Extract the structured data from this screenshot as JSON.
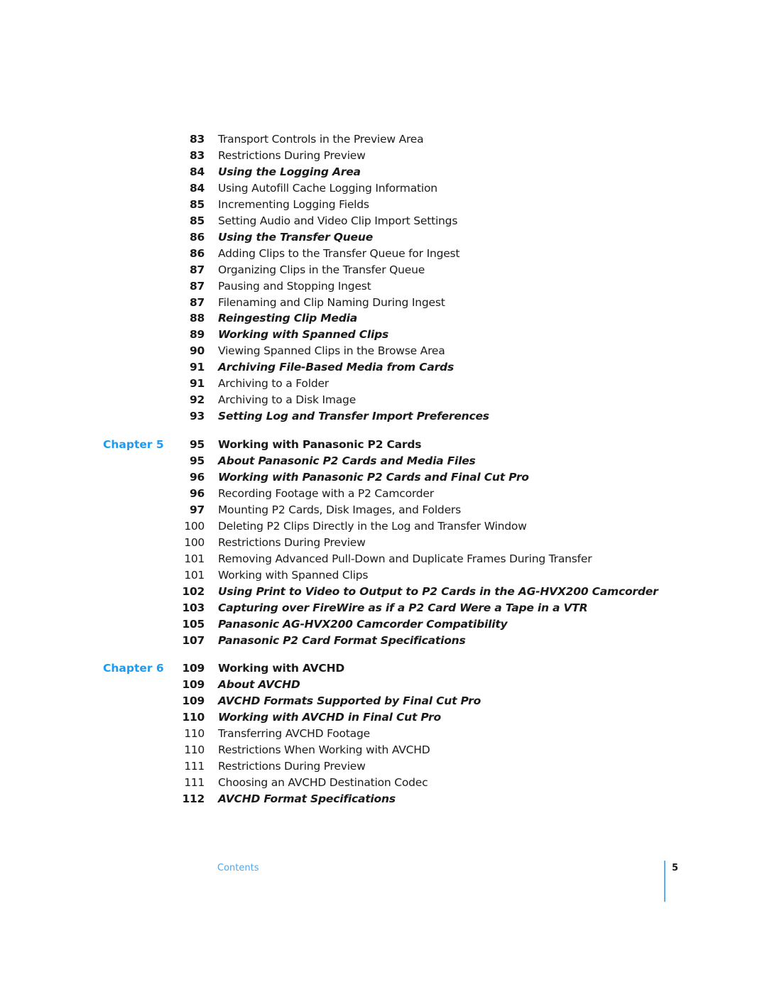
{
  "entries": [
    {
      "page": "83",
      "title": "Transport Controls in the Preview Area",
      "style": "plain"
    },
    {
      "page": "83",
      "title": "Restrictions During Preview",
      "style": "plain"
    },
    {
      "page": "84",
      "title": "Using the Logging Area",
      "style": "italic"
    },
    {
      "page": "84",
      "title": "Using Autofill Cache Logging Information",
      "style": "plain"
    },
    {
      "page": "85",
      "title": "Incrementing Logging Fields",
      "style": "plain"
    },
    {
      "page": "85",
      "title": "Setting Audio and Video Clip Import Settings",
      "style": "plain"
    },
    {
      "page": "86",
      "title": "Using the Transfer Queue",
      "style": "italic"
    },
    {
      "page": "86",
      "title": "Adding Clips to the Transfer Queue for Ingest",
      "style": "plain"
    },
    {
      "page": "87",
      "title": "Organizing Clips in the Transfer Queue",
      "style": "plain"
    },
    {
      "page": "87",
      "title": "Pausing and Stopping Ingest",
      "style": "plain"
    },
    {
      "page": "87",
      "title": "Filenaming and Clip Naming During Ingest",
      "style": "plain"
    },
    {
      "page": "88",
      "title": "Reingesting Clip Media",
      "style": "italic"
    },
    {
      "page": "89",
      "title": "Working with Spanned Clips",
      "style": "italic"
    },
    {
      "page": "90",
      "title": "Viewing Spanned Clips in the Browse Area",
      "style": "plain"
    },
    {
      "page": "91",
      "title": "Archiving File-Based Media from Cards",
      "style": "italic"
    },
    {
      "page": "91",
      "title": "Archiving to a Folder",
      "style": "plain"
    },
    {
      "page": "92",
      "title": "Archiving to a Disk Image",
      "style": "plain"
    },
    {
      "page": "93",
      "title": "Setting Log and Transfer Import Preferences",
      "style": "italic"
    },
    {
      "chapter": "Chapter 5",
      "page": "95",
      "title": "Working with Panasonic P2 Cards",
      "style": "chapter"
    },
    {
      "page": "95",
      "title": "About Panasonic P2 Cards and Media Files",
      "style": "italic"
    },
    {
      "page": "96",
      "title": "Working with Panasonic P2 Cards and Final Cut Pro",
      "style": "italic"
    },
    {
      "page": "96",
      "title": "Recording Footage with a P2 Camcorder",
      "style": "plain"
    },
    {
      "page": "97",
      "title": "Mounting P2 Cards, Disk Images, and Folders",
      "style": "plain"
    },
    {
      "page": "100",
      "title": "Deleting P2 Clips Directly in the Log and Transfer Window",
      "style": "plain"
    },
    {
      "page": "100",
      "title": "Restrictions During Preview",
      "style": "plain"
    },
    {
      "page": "101",
      "title": "Removing Advanced Pull-Down and Duplicate Frames During Transfer",
      "style": "plain"
    },
    {
      "page": "101",
      "title": "Working with Spanned Clips",
      "style": "plain"
    },
    {
      "page": "102",
      "title": "Using Print to Video to Output to P2 Cards in the AG-HVX200 Camcorder",
      "style": "italic"
    },
    {
      "page": "103",
      "title": "Capturing over FireWire as if a P2 Card Were a Tape in a VTR",
      "style": "italic"
    },
    {
      "page": "105",
      "title": "Panasonic AG-HVX200 Camcorder Compatibility",
      "style": "italic"
    },
    {
      "page": "107",
      "title": "Panasonic P2 Card Format Specifications",
      "style": "italic"
    },
    {
      "chapter": "Chapter 6",
      "page": "109",
      "title": "Working with AVCHD",
      "style": "chapter"
    },
    {
      "page": "109",
      "title": "About AVCHD",
      "style": "italic"
    },
    {
      "page": "109",
      "title": "AVCHD Formats Supported by Final Cut Pro",
      "style": "italic"
    },
    {
      "page": "110",
      "title": "Working with AVCHD in Final Cut Pro",
      "style": "italic"
    },
    {
      "page": "110",
      "title": "Transferring AVCHD Footage",
      "style": "plain"
    },
    {
      "page": "110",
      "title": "Restrictions When Working with AVCHD",
      "style": "plain"
    },
    {
      "page": "111",
      "title": "Restrictions During Preview",
      "style": "plain"
    },
    {
      "page": "111",
      "title": "Choosing an AVCHD Destination Codec",
      "style": "plain"
    },
    {
      "page": "112",
      "title": "AVCHD Format Specifications",
      "style": "italic"
    }
  ],
  "footer": {
    "section": "Contents",
    "page_number": "5"
  },
  "colors": {
    "accent": "#1d9bf0",
    "text": "#1a1a1a"
  }
}
